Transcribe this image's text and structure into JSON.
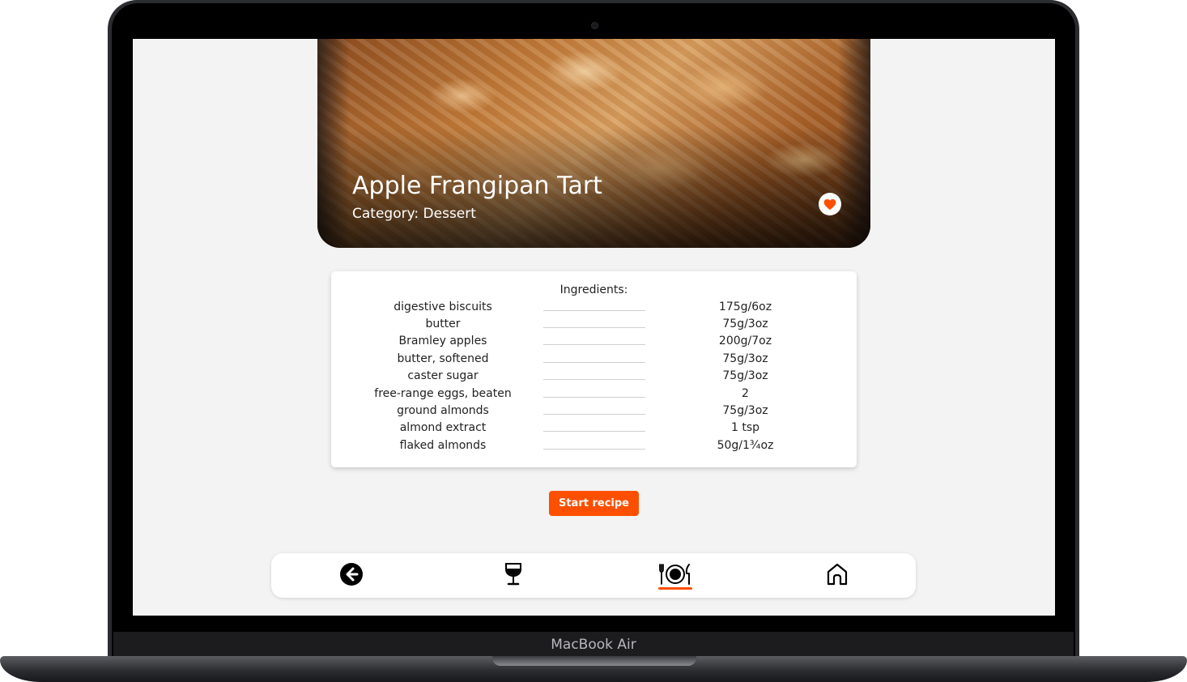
{
  "device": {
    "label": "MacBook Air"
  },
  "recipe": {
    "title": "Apple Frangipan Tart",
    "category_line": "Category: Dessert",
    "favorite_icon": "heart-icon"
  },
  "ingredients": {
    "heading": "Ingredients:",
    "items": [
      {
        "name": "digestive biscuits",
        "quantity": "175g/6oz"
      },
      {
        "name": "butter",
        "quantity": "75g/3oz"
      },
      {
        "name": "Bramley apples",
        "quantity": "200g/7oz"
      },
      {
        "name": "butter, softened",
        "quantity": "75g/3oz"
      },
      {
        "name": "caster sugar",
        "quantity": "75g/3oz"
      },
      {
        "name": "free-range eggs, beaten",
        "quantity": "2"
      },
      {
        "name": "ground almonds",
        "quantity": "75g/3oz"
      },
      {
        "name": "almond extract",
        "quantity": "1 tsp"
      },
      {
        "name": "flaked almonds",
        "quantity": "50g/1¾oz"
      }
    ]
  },
  "actions": {
    "start_label": "Start recipe"
  },
  "nav": {
    "items": [
      {
        "icon": "back-arrow-icon",
        "active": false
      },
      {
        "icon": "wine-glass-icon",
        "active": false
      },
      {
        "icon": "plate-cutlery-icon",
        "active": true
      },
      {
        "icon": "home-icon",
        "active": false
      }
    ]
  },
  "colors": {
    "accent": "#fd4f00",
    "background": "#f3f3f3",
    "card": "#ffffff",
    "text": "#222222"
  }
}
